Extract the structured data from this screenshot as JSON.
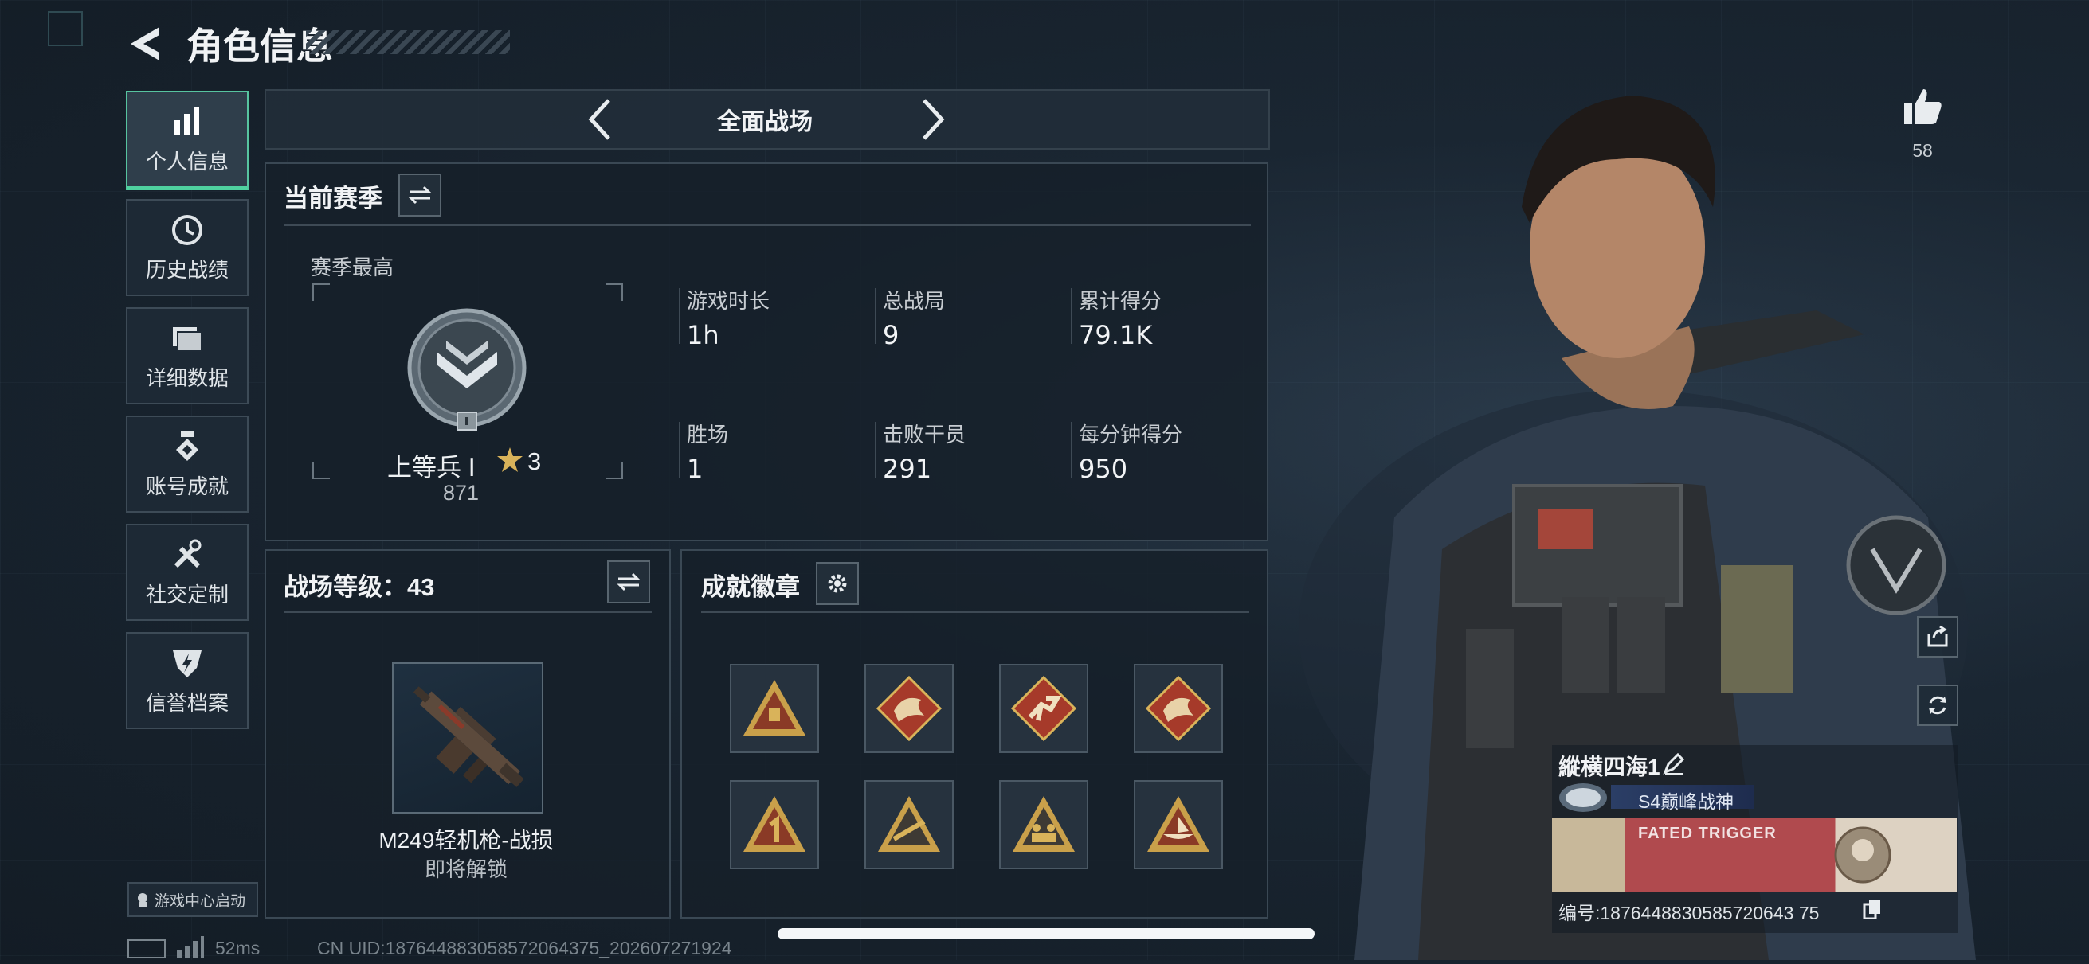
{
  "header": {
    "title": "角色信息"
  },
  "sidebar": {
    "items": [
      {
        "label": "个人信息",
        "icon": "bar-chart-icon",
        "active": true
      },
      {
        "label": "历史战绩",
        "icon": "history-clock-icon"
      },
      {
        "label": "详细数据",
        "icon": "folder-icon"
      },
      {
        "label": "账号成就",
        "icon": "medal-icon"
      },
      {
        "label": "社交定制",
        "icon": "tools-icon"
      },
      {
        "label": "信誉档案",
        "icon": "shield-icon"
      }
    ],
    "game_center": "游戏中心启动"
  },
  "mode_selector": {
    "label": "全面战场"
  },
  "season": {
    "title": "当前赛季",
    "highest_label": "赛季最高",
    "rank_name": "上等兵 Ⅰ",
    "rank_stars": "3",
    "rank_points": "871",
    "stats": [
      {
        "label": "游戏时长",
        "value": "1h"
      },
      {
        "label": "总战局",
        "value": "9"
      },
      {
        "label": "累计得分",
        "value": "79.1K"
      },
      {
        "label": "胜场",
        "value": "1"
      },
      {
        "label": "击败干员",
        "value": "291"
      },
      {
        "label": "每分钟得分",
        "value": "950"
      }
    ]
  },
  "battlefield_level": {
    "title": "战场等级：43",
    "weapon_name": "M249轻机枪-战损",
    "weapon_status": "即将解锁"
  },
  "achievements": {
    "title": "成就徽章"
  },
  "right": {
    "likes": "58",
    "player_name": "縱横四海1",
    "player_title": "S4巅峰战神",
    "player_id": "编号:1876448830585720643 75",
    "banner_text": "FATED TRIGGER"
  },
  "footer": {
    "ping": "52ms",
    "uid": "CN UID:187644883058572064375_202607271924"
  },
  "colors": {
    "accent": "#4fd19f",
    "gold": "#c9a04a",
    "badge_red": "#a63a2a"
  }
}
